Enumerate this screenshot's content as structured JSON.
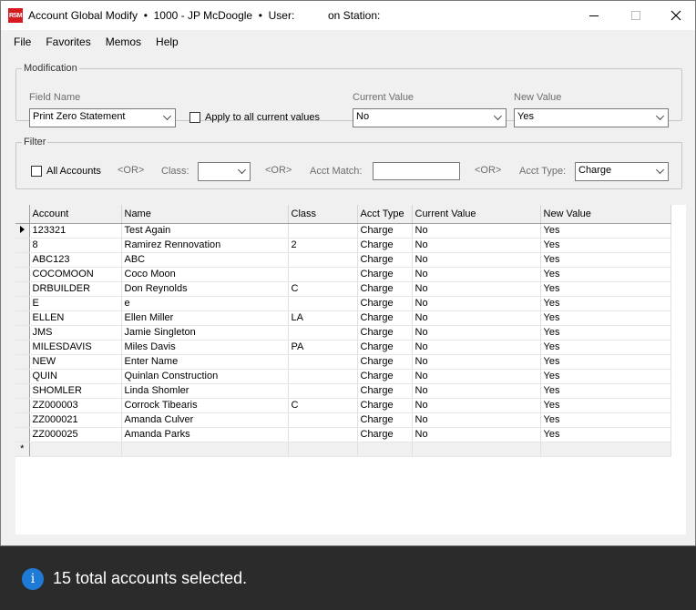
{
  "window": {
    "logo_text": "RSM",
    "title": "Account Global Modify  •  1000 - JP McDoogle  •  User:           on Station:"
  },
  "menu": [
    "File",
    "Favorites",
    "Memos",
    "Help"
  ],
  "modification": {
    "legend": "Modification",
    "field_name_label": "Field Name",
    "field_name_value": "Print Zero Statement",
    "apply_all_label": "Apply to all current values",
    "current_value_label": "Current Value",
    "current_value": "No",
    "new_value_label": "New Value",
    "new_value": "Yes"
  },
  "filter": {
    "legend": "Filter",
    "all_accounts_label": "All Accounts",
    "or_text": "<OR>",
    "class_label": "Class:",
    "class_value": "",
    "acct_match_label": "Acct Match:",
    "acct_match_value": "",
    "acct_type_label": "Acct Type:",
    "acct_type_value": "Charge"
  },
  "grid": {
    "columns": [
      "Account",
      "Name",
      "Class",
      "Acct Type",
      "Current Value",
      "New Value"
    ],
    "rows": [
      [
        "123321",
        "Test Again",
        "",
        "Charge",
        "No",
        "Yes"
      ],
      [
        "8",
        "Ramirez Rennovation",
        "2",
        "Charge",
        "No",
        "Yes"
      ],
      [
        "ABC123",
        "ABC",
        "",
        "Charge",
        "No",
        "Yes"
      ],
      [
        "COCOMOON",
        "Coco Moon",
        "",
        "Charge",
        "No",
        "Yes"
      ],
      [
        "DRBUILDER",
        "Don Reynolds",
        "C",
        "Charge",
        "No",
        "Yes"
      ],
      [
        "E",
        "e",
        "",
        "Charge",
        "No",
        "Yes"
      ],
      [
        "ELLEN",
        "Ellen Miller",
        "LA",
        "Charge",
        "No",
        "Yes"
      ],
      [
        "JMS",
        "Jamie Singleton",
        "",
        "Charge",
        "No",
        "Yes"
      ],
      [
        "MILESDAVIS",
        "Miles Davis",
        "PA",
        "Charge",
        "No",
        "Yes"
      ],
      [
        "NEW",
        "Enter Name",
        "",
        "Charge",
        "No",
        "Yes"
      ],
      [
        "QUIN",
        "Quinlan Construction",
        "",
        "Charge",
        "No",
        "Yes"
      ],
      [
        "SHOMLER",
        "Linda Shomler",
        "",
        "Charge",
        "No",
        "Yes"
      ],
      [
        "ZZ000003",
        "Corrock Tibearis",
        "C",
        "Charge",
        "No",
        "Yes"
      ],
      [
        "ZZ000021",
        "Amanda Culver",
        "",
        "Charge",
        "No",
        "Yes"
      ],
      [
        "ZZ000025",
        "Amanda Parks",
        "",
        "Charge",
        "No",
        "Yes"
      ]
    ],
    "new_row_marker": "*"
  },
  "status": {
    "icon_glyph": "i",
    "message": "15 total accounts selected."
  }
}
